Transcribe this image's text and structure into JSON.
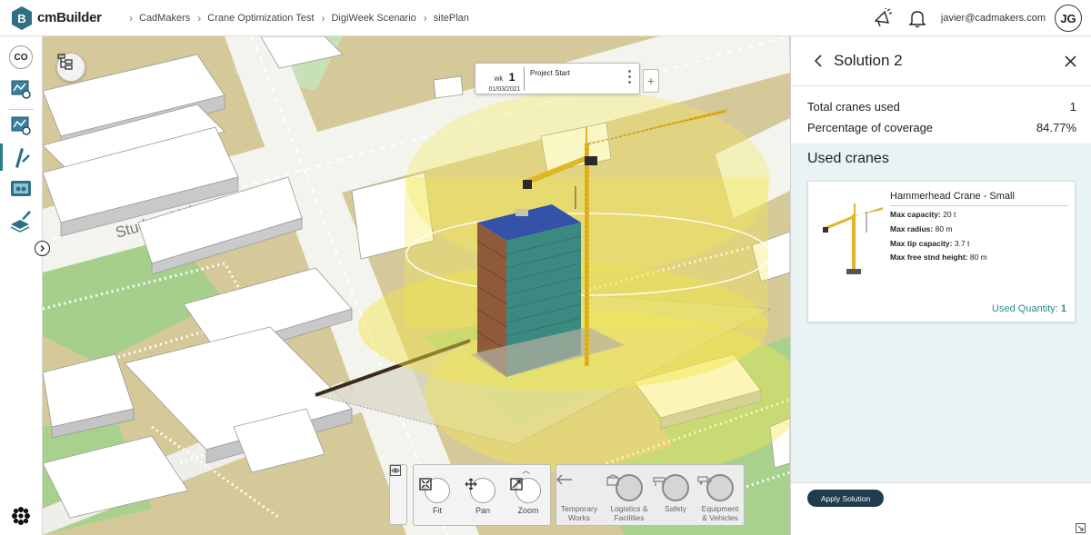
{
  "app": {
    "name": "cmBuilder",
    "logo_letter": "B"
  },
  "breadcrumb": [
    "CadMakers",
    "Crane Optimization Test",
    "DigiWeek Scenario",
    "sitePlan"
  ],
  "user": {
    "email": "javier@cadmakers.com",
    "initials": "JG"
  },
  "rail": {
    "co_label": "CO",
    "items": [
      "schedule-icon",
      "crane-setup-icon",
      "crane-icon",
      "logistics-icon",
      "layers-brush-icon"
    ]
  },
  "map": {
    "street_label": "Student Union B",
    "timeline": {
      "week_prefix": "wk",
      "week_number": "1",
      "date": "01/03/2021",
      "label": "Project Start"
    },
    "nav": {
      "fit": "Fit",
      "pan": "Pan",
      "zoom": "Zoom"
    },
    "tools": {
      "temporary_works": [
        "Temporary",
        "Works"
      ],
      "logistics": [
        "Logistics &",
        "Facilities"
      ],
      "safety": [
        "Safety"
      ],
      "equipment": [
        "Equipment",
        "& Vehicles"
      ]
    }
  },
  "panel": {
    "title": "Solution 2",
    "stats": [
      {
        "label": "Total cranes used",
        "value": "1"
      },
      {
        "label": "Percentage of coverage",
        "value": "84.77%"
      }
    ],
    "used_cranes_title": "Used cranes",
    "crane": {
      "name": "Hammerhead Crane - Small",
      "specs": [
        {
          "label": "Max capacity:",
          "value": "20 t"
        },
        {
          "label": "Max radius:",
          "value": "80 m"
        },
        {
          "label": "Max tip capacity:",
          "value": "3.7 t"
        },
        {
          "label": "Max free stnd height:",
          "value": "80 m"
        }
      ],
      "used_quantity_label": "Used Quantity:",
      "used_quantity": "1"
    },
    "apply_label": "Apply Solution"
  },
  "colors": {
    "accent": "#2d7d8a",
    "apply_button": "#1f3d4d",
    "coverage": "#f5ec4a"
  }
}
